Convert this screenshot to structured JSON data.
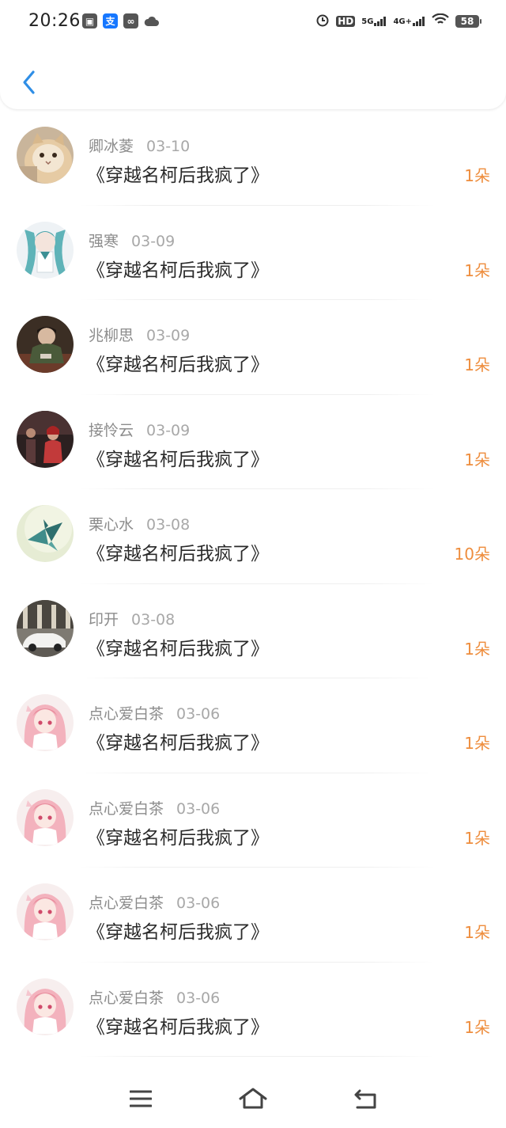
{
  "status_bar": {
    "time": "20:26",
    "battery": "58",
    "network_labels": [
      "HD",
      "5G",
      "4G+"
    ],
    "left_icon_names": [
      "wallet-icon",
      "alipay-icon",
      "link-icon",
      "cloud-icon"
    ]
  },
  "header": {
    "back_icon": "chevron-left-icon",
    "accent_color": "#2f8ee6"
  },
  "colors": {
    "count": "#ee8d3d",
    "name": "#8c8c8c",
    "title": "#2a2a2a"
  },
  "records": [
    {
      "name": "卿冰菱",
      "date": "03-10",
      "title": "《穿越名柯后我疯了》",
      "count": "1朵",
      "avatar": "cat-avatar"
    },
    {
      "name": "强寒",
      "date": "03-09",
      "title": "《穿越名柯后我疯了》",
      "count": "1朵",
      "avatar": "miku-avatar"
    },
    {
      "name": "兆柳思",
      "date": "03-09",
      "title": "《穿越名柯后我疯了》",
      "count": "1朵",
      "avatar": "soldier-avatar"
    },
    {
      "name": "接怜云",
      "date": "03-09",
      "title": "《穿越名柯后我疯了》",
      "count": "1朵",
      "avatar": "stage-avatar"
    },
    {
      "name": "栗心水",
      "date": "03-08",
      "title": "《穿越名柯后我疯了》",
      "count": "10朵",
      "avatar": "paper-crane-avatar"
    },
    {
      "name": "印开",
      "date": "03-08",
      "title": "《穿越名柯后我疯了》",
      "count": "1朵",
      "avatar": "car-avatar"
    },
    {
      "name": "点心爱白茶",
      "date": "03-06",
      "title": "《穿越名柯后我疯了》",
      "count": "1朵",
      "avatar": "pink-anime-avatar"
    },
    {
      "name": "点心爱白茶",
      "date": "03-06",
      "title": "《穿越名柯后我疯了》",
      "count": "1朵",
      "avatar": "pink-anime-avatar"
    },
    {
      "name": "点心爱白茶",
      "date": "03-06",
      "title": "《穿越名柯后我疯了》",
      "count": "1朵",
      "avatar": "pink-anime-avatar"
    },
    {
      "name": "点心爱白茶",
      "date": "03-06",
      "title": "《穿越名柯后我疯了》",
      "count": "1朵",
      "avatar": "pink-anime-avatar"
    }
  ],
  "nav": {
    "icons": [
      "menu-icon",
      "home-icon",
      "back-icon"
    ]
  }
}
